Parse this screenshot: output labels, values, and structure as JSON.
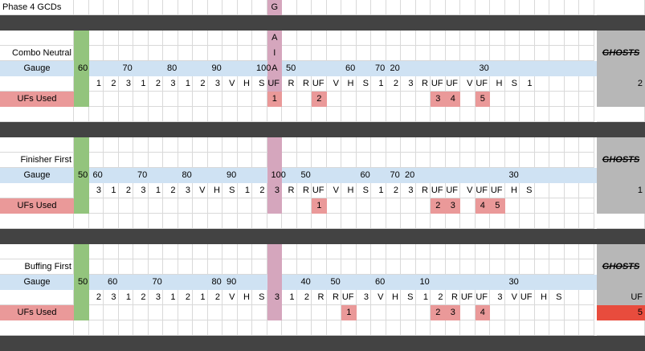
{
  "colors": {
    "gauge_row": "#cfe2f3",
    "uf_row": "#ea9999",
    "uf_label": "#e6b8af",
    "green_col": "#93c47d",
    "pink_col": "#d5a6bd",
    "gray_col": "#b7b7b7",
    "dark_bar": "#434343",
    "red_cell": "#e84c3d",
    "grid": "#d9d9d9"
  },
  "sheet": {
    "title": "Phase 4 GCDs",
    "gaia_letters": [
      "G",
      "A",
      "I",
      "A"
    ],
    "ghosts_label": "GHOSTS",
    "gauge_label": "Gauge",
    "ufs_label": "UFs Used",
    "sections": [
      {
        "name": "Combo Neutral",
        "gauge": [
          {
            "c": 1,
            "v": "60"
          },
          {
            "c": 4,
            "v": "70"
          },
          {
            "c": 7,
            "v": "80"
          },
          {
            "c": 10,
            "v": "90"
          },
          {
            "c": 13,
            "v": "100"
          },
          {
            "c": 15,
            "v": "50"
          },
          {
            "c": 19,
            "v": "60"
          },
          {
            "c": 21,
            "v": "70"
          },
          {
            "c": 22,
            "v": "20"
          },
          {
            "c": 28,
            "v": "30"
          }
        ],
        "actions": [
          {
            "c": 2,
            "v": "1"
          },
          {
            "c": 3,
            "v": "2"
          },
          {
            "c": 4,
            "v": "3"
          },
          {
            "c": 5,
            "v": "1"
          },
          {
            "c": 6,
            "v": "2"
          },
          {
            "c": 7,
            "v": "3"
          },
          {
            "c": 8,
            "v": "1"
          },
          {
            "c": 9,
            "v": "2"
          },
          {
            "c": 10,
            "v": "3"
          },
          {
            "c": 11,
            "v": "V"
          },
          {
            "c": 12,
            "v": "H"
          },
          {
            "c": 13,
            "v": "S"
          },
          {
            "c": 14,
            "v": "UF"
          },
          {
            "c": 15,
            "v": "R"
          },
          {
            "c": 16,
            "v": "R"
          },
          {
            "c": 17,
            "v": "UF"
          },
          {
            "c": 18,
            "v": "V"
          },
          {
            "c": 19,
            "v": "H"
          },
          {
            "c": 20,
            "v": "S"
          },
          {
            "c": 21,
            "v": "1"
          },
          {
            "c": 22,
            "v": "2"
          },
          {
            "c": 23,
            "v": "3"
          },
          {
            "c": 24,
            "v": "R"
          },
          {
            "c": 25,
            "v": "UF"
          },
          {
            "c": 26,
            "v": "UF"
          },
          {
            "c": 27,
            "v": "V"
          },
          {
            "c": 28,
            "v": "UF"
          },
          {
            "c": 29,
            "v": "H"
          },
          {
            "c": 30,
            "v": "S"
          },
          {
            "c": 31,
            "v": "1"
          }
        ],
        "ghost_count": "2",
        "ufs": [
          {
            "c": 14,
            "v": "1"
          },
          {
            "c": 17,
            "v": "2"
          },
          {
            "c": 25,
            "v": "3"
          },
          {
            "c": 26,
            "v": "4"
          },
          {
            "c": 28,
            "v": "5"
          }
        ],
        "ghost_uf": "",
        "ghost_uf_total": "",
        "ghost_red": false
      },
      {
        "name": "Finisher First",
        "gauge": [
          {
            "c": 1,
            "v": "50"
          },
          {
            "c": 2,
            "v": "60"
          },
          {
            "c": 5,
            "v": "70"
          },
          {
            "c": 8,
            "v": "80"
          },
          {
            "c": 11,
            "v": "90"
          },
          {
            "c": 14,
            "v": "100"
          },
          {
            "c": 16,
            "v": "50"
          },
          {
            "c": 20,
            "v": "60"
          },
          {
            "c": 22,
            "v": "70"
          },
          {
            "c": 23,
            "v": "20"
          },
          {
            "c": 30,
            "v": "30"
          }
        ],
        "actions": [
          {
            "c": 2,
            "v": "3"
          },
          {
            "c": 3,
            "v": "1"
          },
          {
            "c": 4,
            "v": "2"
          },
          {
            "c": 5,
            "v": "3"
          },
          {
            "c": 6,
            "v": "1"
          },
          {
            "c": 7,
            "v": "2"
          },
          {
            "c": 8,
            "v": "3"
          },
          {
            "c": 9,
            "v": "V"
          },
          {
            "c": 10,
            "v": "H"
          },
          {
            "c": 11,
            "v": "S"
          },
          {
            "c": 12,
            "v": "1"
          },
          {
            "c": 13,
            "v": "2"
          },
          {
            "c": 14,
            "v": "3"
          },
          {
            "c": 15,
            "v": "R"
          },
          {
            "c": 16,
            "v": "R"
          },
          {
            "c": 17,
            "v": "UF"
          },
          {
            "c": 18,
            "v": "V"
          },
          {
            "c": 19,
            "v": "H"
          },
          {
            "c": 20,
            "v": "S"
          },
          {
            "c": 21,
            "v": "1"
          },
          {
            "c": 22,
            "v": "2"
          },
          {
            "c": 23,
            "v": "3"
          },
          {
            "c": 24,
            "v": "R"
          },
          {
            "c": 25,
            "v": "UF"
          },
          {
            "c": 26,
            "v": "UF"
          },
          {
            "c": 27,
            "v": "V"
          },
          {
            "c": 28,
            "v": "UF"
          },
          {
            "c": 29,
            "v": "UF"
          },
          {
            "c": 30,
            "v": "H"
          },
          {
            "c": 31,
            "v": "S"
          }
        ],
        "ghost_count": "1",
        "ufs": [
          {
            "c": 17,
            "v": "1"
          },
          {
            "c": 25,
            "v": "2"
          },
          {
            "c": 26,
            "v": "3"
          },
          {
            "c": 28,
            "v": "4"
          },
          {
            "c": 29,
            "v": "5"
          }
        ],
        "ghost_uf": "",
        "ghost_uf_total": "",
        "ghost_red": false
      },
      {
        "name": "Buffing First",
        "gauge": [
          {
            "c": 1,
            "v": "50"
          },
          {
            "c": 3,
            "v": "60"
          },
          {
            "c": 6,
            "v": "70"
          },
          {
            "c": 10,
            "v": "80"
          },
          {
            "c": 11,
            "v": "90"
          },
          {
            "c": 16,
            "v": "40"
          },
          {
            "c": 18,
            "v": "50"
          },
          {
            "c": 21,
            "v": "60"
          },
          {
            "c": 24,
            "v": "10"
          },
          {
            "c": 30,
            "v": "30"
          }
        ],
        "actions": [
          {
            "c": 2,
            "v": "2"
          },
          {
            "c": 3,
            "v": "3"
          },
          {
            "c": 4,
            "v": "1"
          },
          {
            "c": 5,
            "v": "2"
          },
          {
            "c": 6,
            "v": "3"
          },
          {
            "c": 7,
            "v": "1"
          },
          {
            "c": 8,
            "v": "2"
          },
          {
            "c": 9,
            "v": "1"
          },
          {
            "c": 10,
            "v": "2"
          },
          {
            "c": 11,
            "v": "V"
          },
          {
            "c": 12,
            "v": "H"
          },
          {
            "c": 13,
            "v": "S"
          },
          {
            "c": 14,
            "v": "3"
          },
          {
            "c": 15,
            "v": "1"
          },
          {
            "c": 16,
            "v": "2"
          },
          {
            "c": 17,
            "v": "R"
          },
          {
            "c": 18,
            "v": "R"
          },
          {
            "c": 19,
            "v": "UF"
          },
          {
            "c": 20,
            "v": "3"
          },
          {
            "c": 21,
            "v": "V"
          },
          {
            "c": 22,
            "v": "H"
          },
          {
            "c": 23,
            "v": "S"
          },
          {
            "c": 24,
            "v": "1"
          },
          {
            "c": 25,
            "v": "2"
          },
          {
            "c": 26,
            "v": "R"
          },
          {
            "c": 27,
            "v": "UF"
          },
          {
            "c": 28,
            "v": "UF"
          },
          {
            "c": 29,
            "v": "3"
          },
          {
            "c": 30,
            "v": "V"
          },
          {
            "c": 31,
            "v": "UF"
          }
        ],
        "ghost_count": "UF",
        "ufs": [
          {
            "c": 19,
            "v": "1"
          },
          {
            "c": 25,
            "v": "2"
          },
          {
            "c": 26,
            "v": "3"
          },
          {
            "c": 28,
            "v": "4"
          }
        ],
        "extra_actions": [
          {
            "c": 32,
            "v": "H"
          },
          {
            "c": 33,
            "v": "S"
          }
        ],
        "ghost_uf": "",
        "ghost_uf_total": "5",
        "ghost_red": true
      }
    ]
  }
}
